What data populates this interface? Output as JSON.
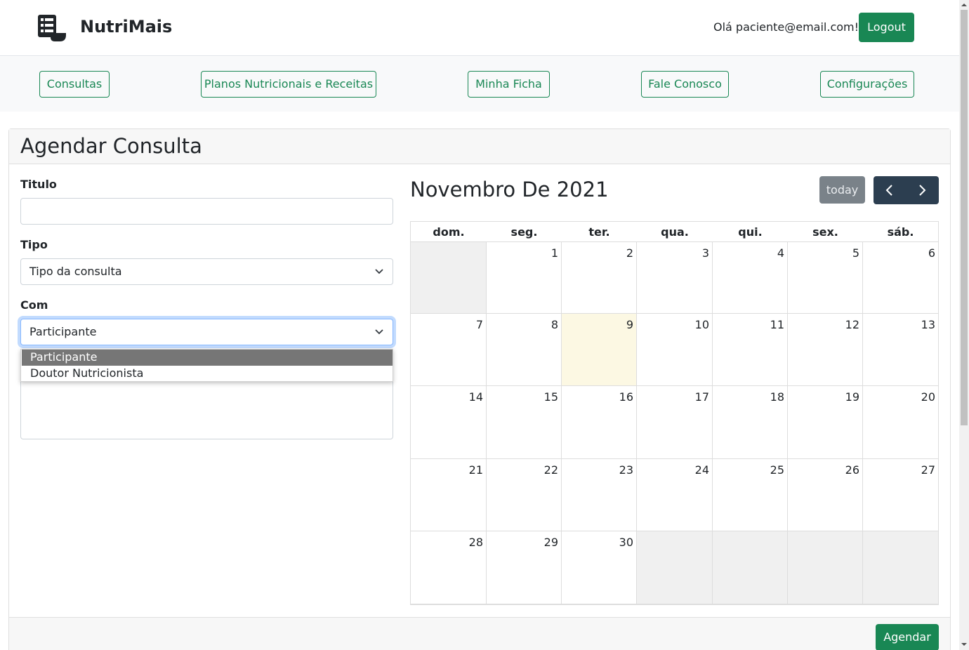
{
  "header": {
    "brand": "NutriMais",
    "logo_icon": "menu-bowl-icon",
    "greeting": "Olá paciente@email.com!",
    "logout_label": "Logout"
  },
  "nav": {
    "items": [
      {
        "label": "Consultas"
      },
      {
        "label": "Planos Nutricionais e Receitas"
      },
      {
        "label": "Minha Ficha"
      },
      {
        "label": "Fale Conosco"
      },
      {
        "label": "Configurações"
      }
    ]
  },
  "card": {
    "title": "Agendar Consulta",
    "submit_label": "Agendar"
  },
  "form": {
    "titulo_label": "Titulo",
    "titulo_value": "",
    "tipo_label": "Tipo",
    "tipo_value": "Tipo da consulta",
    "com_label": "Com",
    "com_value": "Participante",
    "com_options": [
      "Participante",
      "Doutor Nutricionista"
    ],
    "textarea_value": ""
  },
  "calendar": {
    "title": "Novembro De 2021",
    "today_label": "today",
    "prev_icon": "chevron-left-icon",
    "next_icon": "chevron-right-icon",
    "weekdays": [
      "dom.",
      "seg.",
      "ter.",
      "qua.",
      "qui.",
      "sex.",
      "sáb."
    ],
    "weeks": [
      [
        "",
        "1",
        "2",
        "3",
        "4",
        "5",
        "6"
      ],
      [
        "7",
        "8",
        "9",
        "10",
        "11",
        "12",
        "13"
      ],
      [
        "14",
        "15",
        "16",
        "17",
        "18",
        "19",
        "20"
      ],
      [
        "21",
        "22",
        "23",
        "24",
        "25",
        "26",
        "27"
      ],
      [
        "28",
        "29",
        "30",
        "",
        "",
        "",
        ""
      ]
    ],
    "today_day": "9"
  },
  "colors": {
    "primary": "#198754",
    "today_bg": "#fcf8e3",
    "nav_dark": "#2c3e50"
  }
}
